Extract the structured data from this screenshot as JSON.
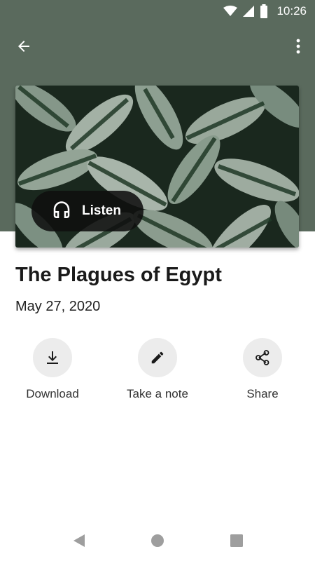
{
  "status_bar": {
    "time": "10:26",
    "icons": [
      "wifi-icon",
      "cell-signal-icon",
      "battery-icon"
    ]
  },
  "app_bar": {
    "back_icon": "arrow-back-icon",
    "more_icon": "more-vert-icon"
  },
  "cover": {
    "image": "green-leaves-photo",
    "listen_label": "Listen",
    "listen_icon": "headphones-icon"
  },
  "episode": {
    "title": "The Plagues of Egypt",
    "date": "May 27, 2020"
  },
  "actions": [
    {
      "label": "Download",
      "icon": "download-icon"
    },
    {
      "label": "Take a note",
      "icon": "pencil-icon"
    },
    {
      "label": "Share",
      "icon": "share-icon"
    }
  ],
  "colors": {
    "header": "#5a6a5d",
    "listen_button": "#0f0f0f",
    "action_circle": "#ececec",
    "nav_icon": "#9e9e9e"
  },
  "nav": {
    "icons": [
      "nav-back-icon",
      "nav-home-icon",
      "nav-recents-icon"
    ]
  }
}
